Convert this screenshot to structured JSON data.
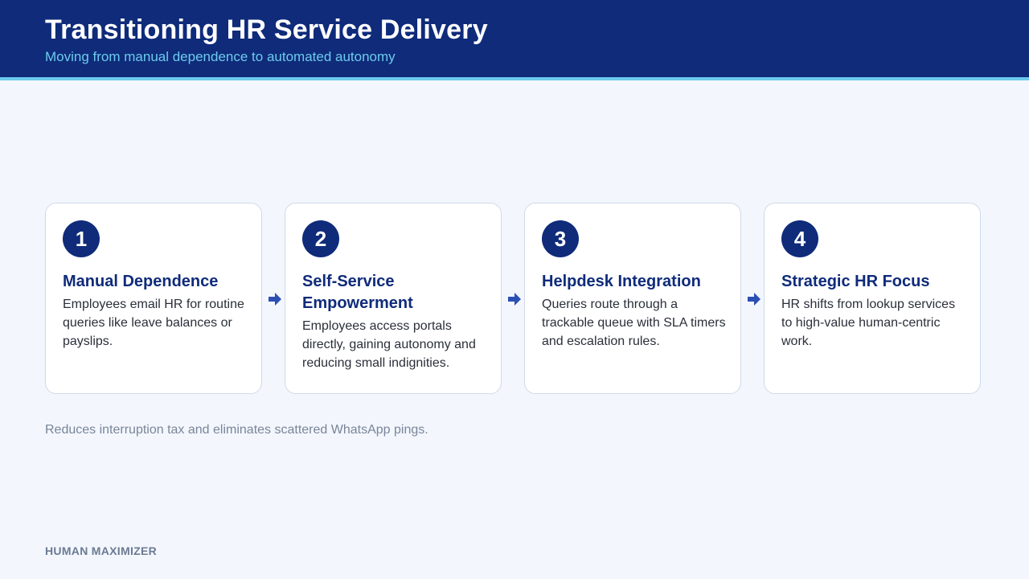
{
  "header": {
    "title": "Transitioning HR Service Delivery",
    "subtitle": "Moving from manual dependence to automated autonomy"
  },
  "steps": [
    {
      "number": "1",
      "title": "Manual Dependence",
      "description": "Employees email HR for routine queries like leave balances or payslips."
    },
    {
      "number": "2",
      "title": "Self-Service Empowerment",
      "description": "Employees access portals directly, gaining autonomy and reducing small indignities."
    },
    {
      "number": "3",
      "title": "Helpdesk Integration",
      "description": "Queries route through a trackable queue with SLA timers and escalation rules."
    },
    {
      "number": "4",
      "title": "Strategic HR Focus",
      "description": "HR shifts from lookup services to high-value human-centric work."
    }
  ],
  "connector_icon": "arrow-right-icon",
  "footnote": "Reduces interruption tax and eliminates scattered WhatsApp pings.",
  "brand": "HUMAN MAXIMIZER",
  "colors": {
    "header_background": "#0f2b7a",
    "accent": "#6ccbed",
    "page_background": "#f3f7fd",
    "badge": "#0f2b7a",
    "arrow": "#2b4fb3"
  }
}
